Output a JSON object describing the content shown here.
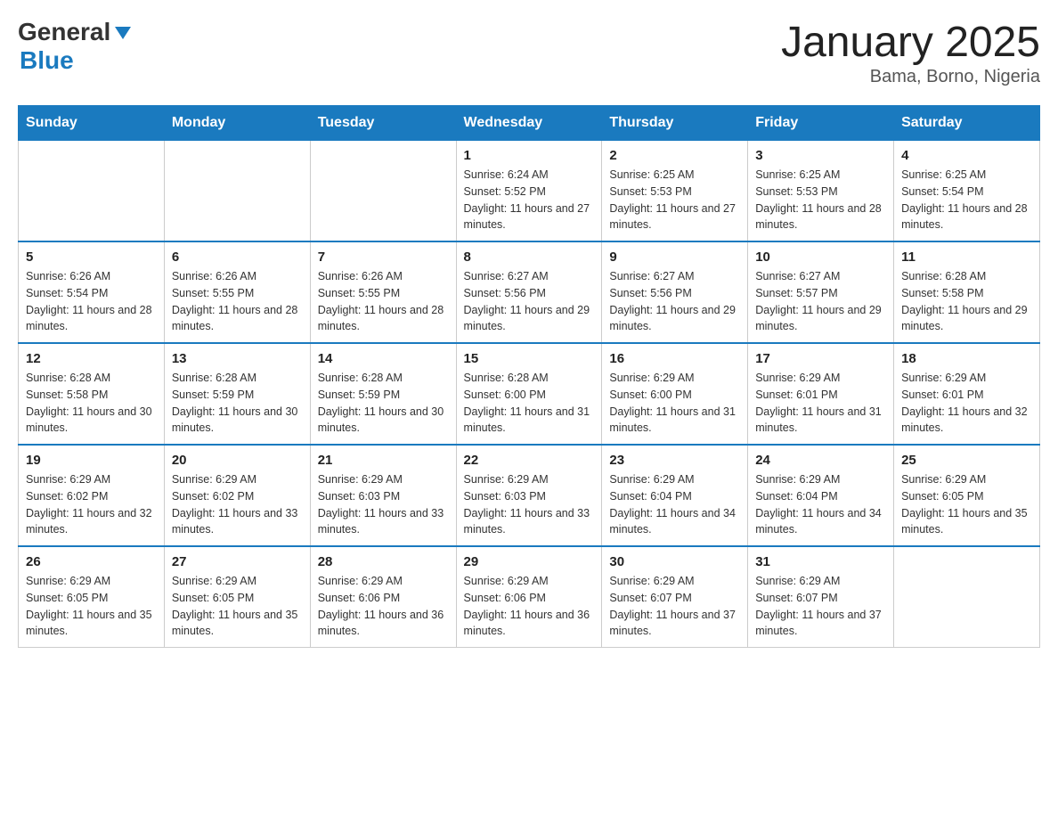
{
  "header": {
    "logo_general": "General",
    "logo_blue": "Blue",
    "title": "January 2025",
    "subtitle": "Bama, Borno, Nigeria"
  },
  "days_of_week": [
    "Sunday",
    "Monday",
    "Tuesday",
    "Wednesday",
    "Thursday",
    "Friday",
    "Saturday"
  ],
  "weeks": [
    [
      {
        "day": "",
        "sunrise": "",
        "sunset": "",
        "daylight": ""
      },
      {
        "day": "",
        "sunrise": "",
        "sunset": "",
        "daylight": ""
      },
      {
        "day": "",
        "sunrise": "",
        "sunset": "",
        "daylight": ""
      },
      {
        "day": "1",
        "sunrise": "Sunrise: 6:24 AM",
        "sunset": "Sunset: 5:52 PM",
        "daylight": "Daylight: 11 hours and 27 minutes."
      },
      {
        "day": "2",
        "sunrise": "Sunrise: 6:25 AM",
        "sunset": "Sunset: 5:53 PM",
        "daylight": "Daylight: 11 hours and 27 minutes."
      },
      {
        "day": "3",
        "sunrise": "Sunrise: 6:25 AM",
        "sunset": "Sunset: 5:53 PM",
        "daylight": "Daylight: 11 hours and 28 minutes."
      },
      {
        "day": "4",
        "sunrise": "Sunrise: 6:25 AM",
        "sunset": "Sunset: 5:54 PM",
        "daylight": "Daylight: 11 hours and 28 minutes."
      }
    ],
    [
      {
        "day": "5",
        "sunrise": "Sunrise: 6:26 AM",
        "sunset": "Sunset: 5:54 PM",
        "daylight": "Daylight: 11 hours and 28 minutes."
      },
      {
        "day": "6",
        "sunrise": "Sunrise: 6:26 AM",
        "sunset": "Sunset: 5:55 PM",
        "daylight": "Daylight: 11 hours and 28 minutes."
      },
      {
        "day": "7",
        "sunrise": "Sunrise: 6:26 AM",
        "sunset": "Sunset: 5:55 PM",
        "daylight": "Daylight: 11 hours and 28 minutes."
      },
      {
        "day": "8",
        "sunrise": "Sunrise: 6:27 AM",
        "sunset": "Sunset: 5:56 PM",
        "daylight": "Daylight: 11 hours and 29 minutes."
      },
      {
        "day": "9",
        "sunrise": "Sunrise: 6:27 AM",
        "sunset": "Sunset: 5:56 PM",
        "daylight": "Daylight: 11 hours and 29 minutes."
      },
      {
        "day": "10",
        "sunrise": "Sunrise: 6:27 AM",
        "sunset": "Sunset: 5:57 PM",
        "daylight": "Daylight: 11 hours and 29 minutes."
      },
      {
        "day": "11",
        "sunrise": "Sunrise: 6:28 AM",
        "sunset": "Sunset: 5:58 PM",
        "daylight": "Daylight: 11 hours and 29 minutes."
      }
    ],
    [
      {
        "day": "12",
        "sunrise": "Sunrise: 6:28 AM",
        "sunset": "Sunset: 5:58 PM",
        "daylight": "Daylight: 11 hours and 30 minutes."
      },
      {
        "day": "13",
        "sunrise": "Sunrise: 6:28 AM",
        "sunset": "Sunset: 5:59 PM",
        "daylight": "Daylight: 11 hours and 30 minutes."
      },
      {
        "day": "14",
        "sunrise": "Sunrise: 6:28 AM",
        "sunset": "Sunset: 5:59 PM",
        "daylight": "Daylight: 11 hours and 30 minutes."
      },
      {
        "day": "15",
        "sunrise": "Sunrise: 6:28 AM",
        "sunset": "Sunset: 6:00 PM",
        "daylight": "Daylight: 11 hours and 31 minutes."
      },
      {
        "day": "16",
        "sunrise": "Sunrise: 6:29 AM",
        "sunset": "Sunset: 6:00 PM",
        "daylight": "Daylight: 11 hours and 31 minutes."
      },
      {
        "day": "17",
        "sunrise": "Sunrise: 6:29 AM",
        "sunset": "Sunset: 6:01 PM",
        "daylight": "Daylight: 11 hours and 31 minutes."
      },
      {
        "day": "18",
        "sunrise": "Sunrise: 6:29 AM",
        "sunset": "Sunset: 6:01 PM",
        "daylight": "Daylight: 11 hours and 32 minutes."
      }
    ],
    [
      {
        "day": "19",
        "sunrise": "Sunrise: 6:29 AM",
        "sunset": "Sunset: 6:02 PM",
        "daylight": "Daylight: 11 hours and 32 minutes."
      },
      {
        "day": "20",
        "sunrise": "Sunrise: 6:29 AM",
        "sunset": "Sunset: 6:02 PM",
        "daylight": "Daylight: 11 hours and 33 minutes."
      },
      {
        "day": "21",
        "sunrise": "Sunrise: 6:29 AM",
        "sunset": "Sunset: 6:03 PM",
        "daylight": "Daylight: 11 hours and 33 minutes."
      },
      {
        "day": "22",
        "sunrise": "Sunrise: 6:29 AM",
        "sunset": "Sunset: 6:03 PM",
        "daylight": "Daylight: 11 hours and 33 minutes."
      },
      {
        "day": "23",
        "sunrise": "Sunrise: 6:29 AM",
        "sunset": "Sunset: 6:04 PM",
        "daylight": "Daylight: 11 hours and 34 minutes."
      },
      {
        "day": "24",
        "sunrise": "Sunrise: 6:29 AM",
        "sunset": "Sunset: 6:04 PM",
        "daylight": "Daylight: 11 hours and 34 minutes."
      },
      {
        "day": "25",
        "sunrise": "Sunrise: 6:29 AM",
        "sunset": "Sunset: 6:05 PM",
        "daylight": "Daylight: 11 hours and 35 minutes."
      }
    ],
    [
      {
        "day": "26",
        "sunrise": "Sunrise: 6:29 AM",
        "sunset": "Sunset: 6:05 PM",
        "daylight": "Daylight: 11 hours and 35 minutes."
      },
      {
        "day": "27",
        "sunrise": "Sunrise: 6:29 AM",
        "sunset": "Sunset: 6:05 PM",
        "daylight": "Daylight: 11 hours and 35 minutes."
      },
      {
        "day": "28",
        "sunrise": "Sunrise: 6:29 AM",
        "sunset": "Sunset: 6:06 PM",
        "daylight": "Daylight: 11 hours and 36 minutes."
      },
      {
        "day": "29",
        "sunrise": "Sunrise: 6:29 AM",
        "sunset": "Sunset: 6:06 PM",
        "daylight": "Daylight: 11 hours and 36 minutes."
      },
      {
        "day": "30",
        "sunrise": "Sunrise: 6:29 AM",
        "sunset": "Sunset: 6:07 PM",
        "daylight": "Daylight: 11 hours and 37 minutes."
      },
      {
        "day": "31",
        "sunrise": "Sunrise: 6:29 AM",
        "sunset": "Sunset: 6:07 PM",
        "daylight": "Daylight: 11 hours and 37 minutes."
      },
      {
        "day": "",
        "sunrise": "",
        "sunset": "",
        "daylight": ""
      }
    ]
  ]
}
